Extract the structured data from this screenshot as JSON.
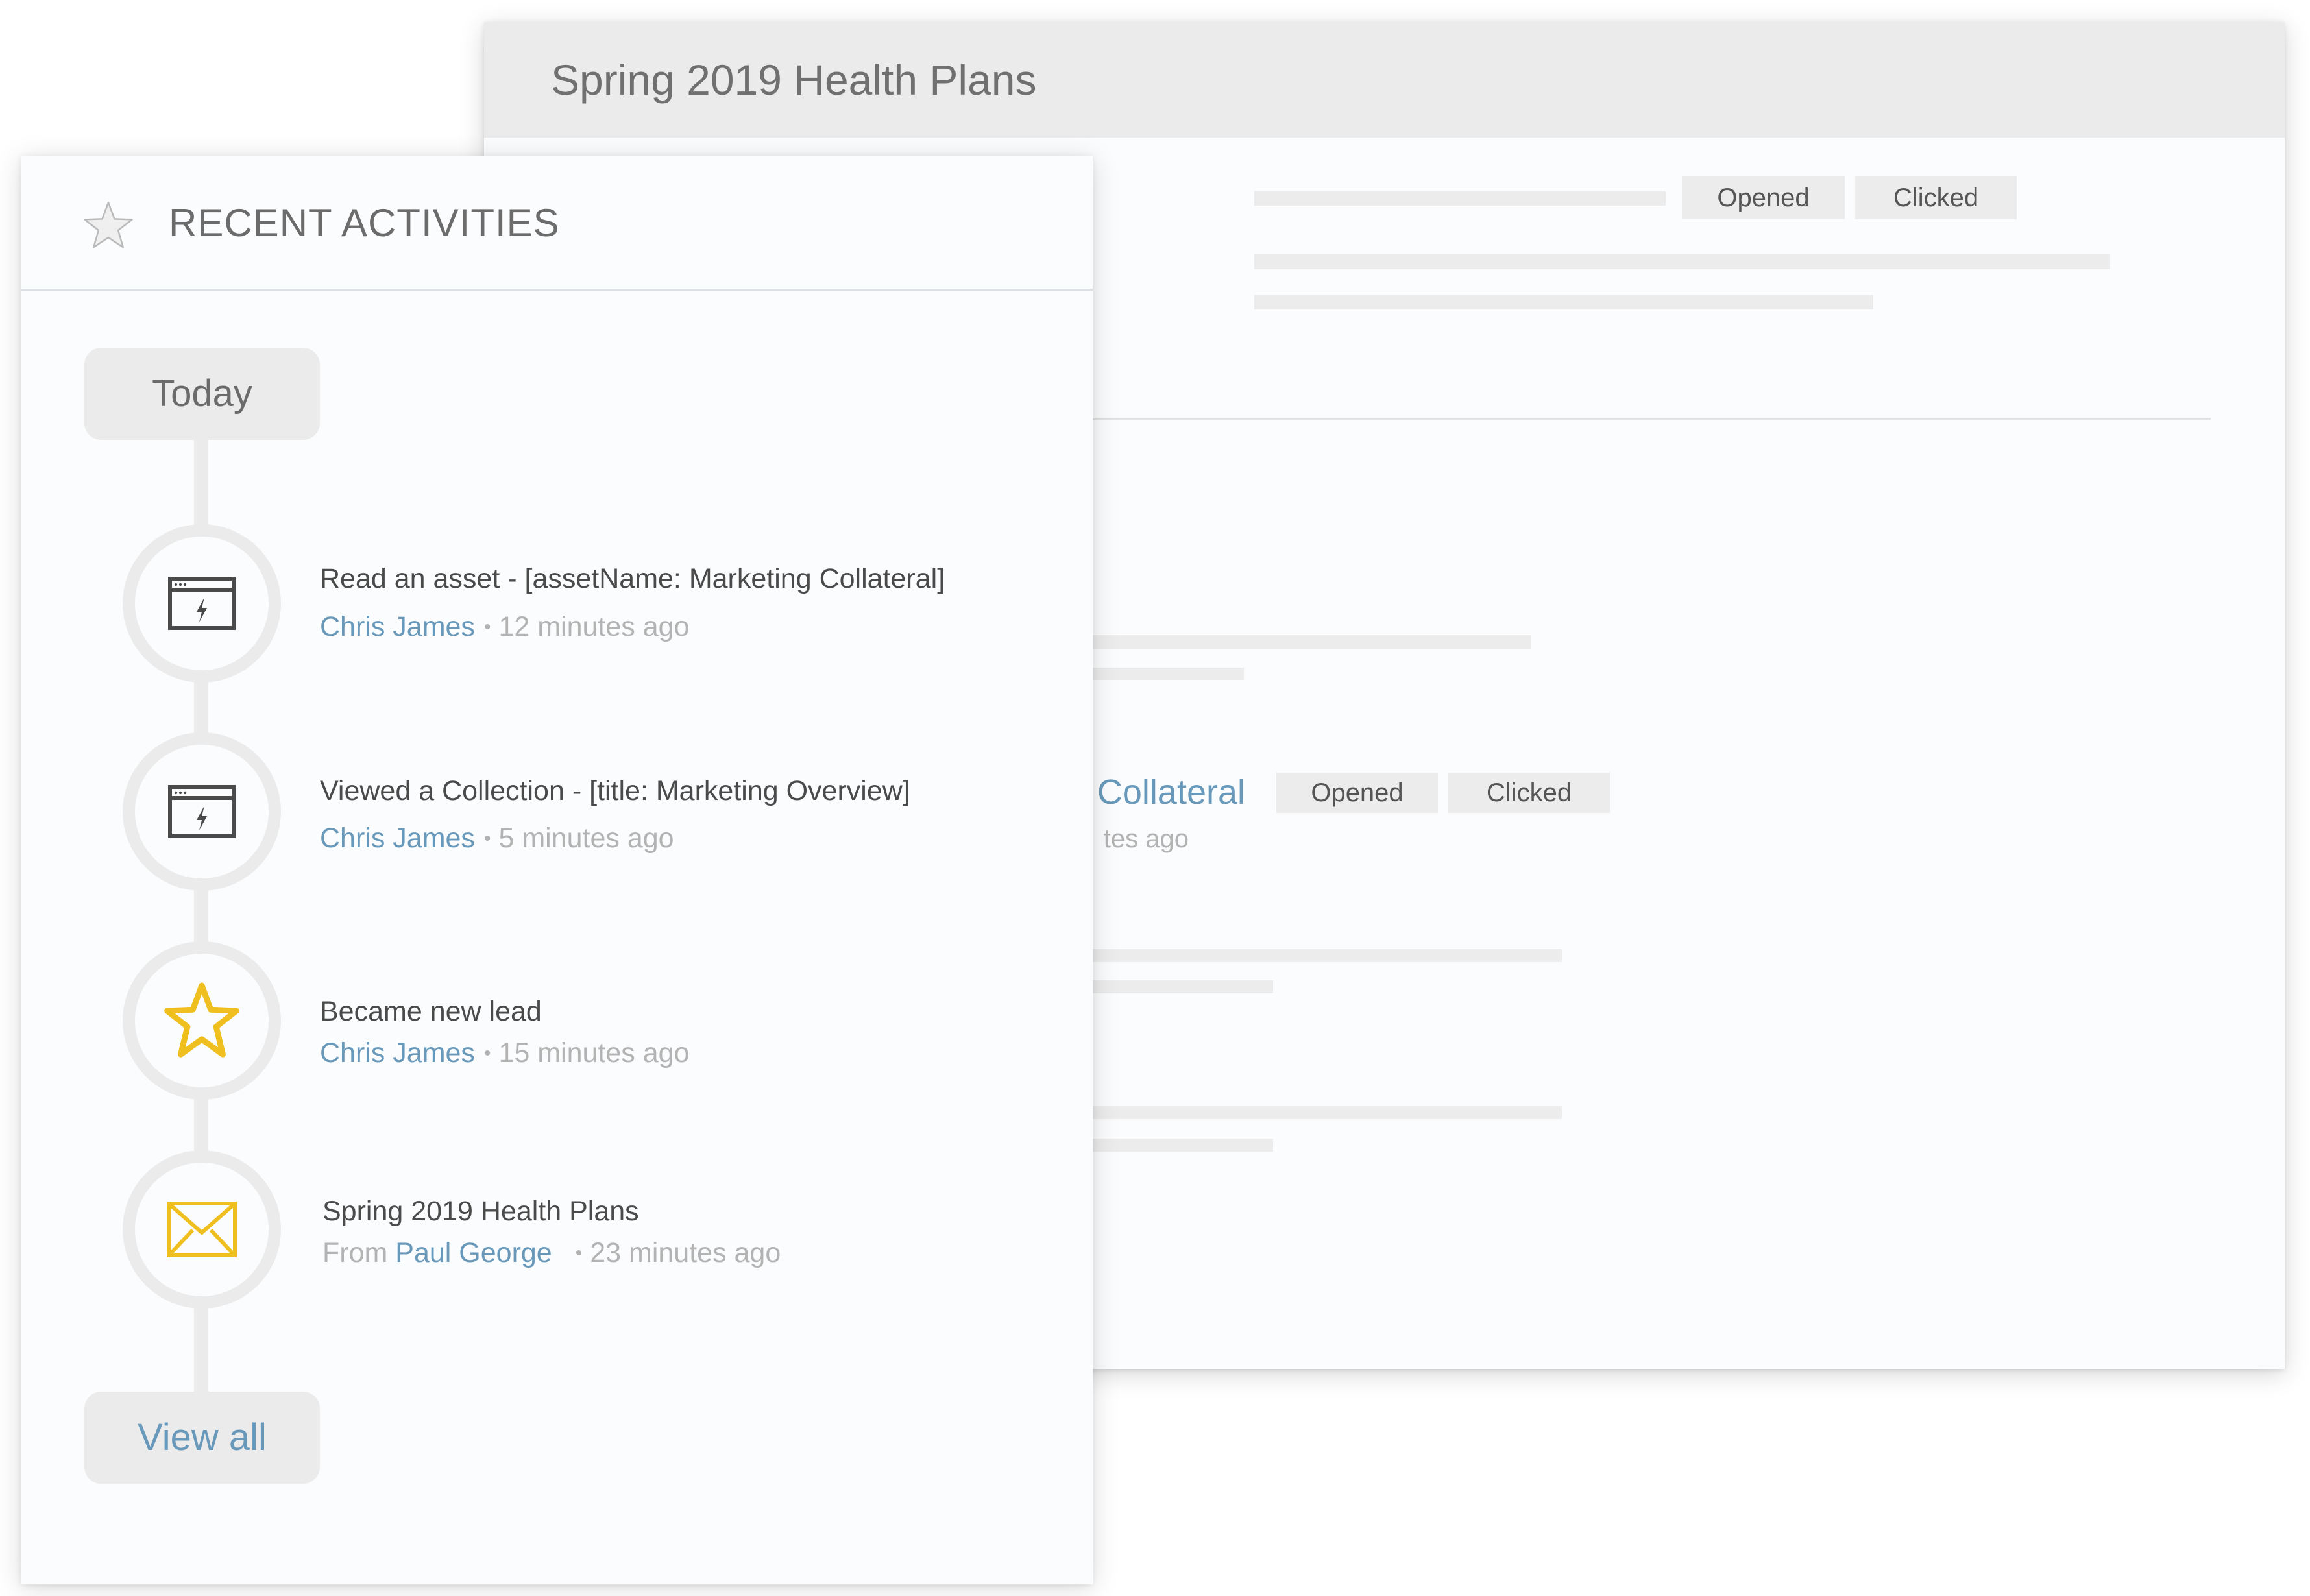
{
  "back_panel": {
    "title": "Spring 2019 Health Plans",
    "row1": {
      "tags": [
        "Opened",
        "Clicked"
      ]
    },
    "row2": {
      "link_fragment": "Collateral",
      "meta_fragment": "tes ago",
      "tags": [
        "Opened",
        "Clicked"
      ]
    }
  },
  "recent_activities": {
    "header_icon": "star-outline-icon",
    "title": "RECENT ACTIVITIES",
    "date_group": "Today",
    "items": [
      {
        "icon": "browser-bolt-icon",
        "title": "Read an asset - [assetName: Marketing Collateral]",
        "from_label": "",
        "person": "Chris James",
        "separator": "•",
        "time": "12 minutes ago"
      },
      {
        "icon": "browser-bolt-icon",
        "title": "Viewed a Collection - [title: Marketing Overview]",
        "from_label": "",
        "person": "Chris James",
        "separator": "•",
        "time": "5 minutes ago"
      },
      {
        "icon": "star-icon",
        "title": "Became new lead",
        "from_label": "",
        "person": "Chris James",
        "separator": "•",
        "time": "15 minutes ago"
      },
      {
        "icon": "envelope-icon",
        "title": "Spring 2019 Health Plans",
        "from_label": "From",
        "person": "Paul George",
        "separator": "•",
        "time": "23 minutes ago"
      }
    ],
    "view_all_label": "View all"
  },
  "colors": {
    "link": "#6899ba",
    "accent_yellow": "#efbf1f",
    "text_dark": "#4a4a4a",
    "text_muted": "#b3b3b3",
    "pill_bg": "#ebebeb"
  }
}
